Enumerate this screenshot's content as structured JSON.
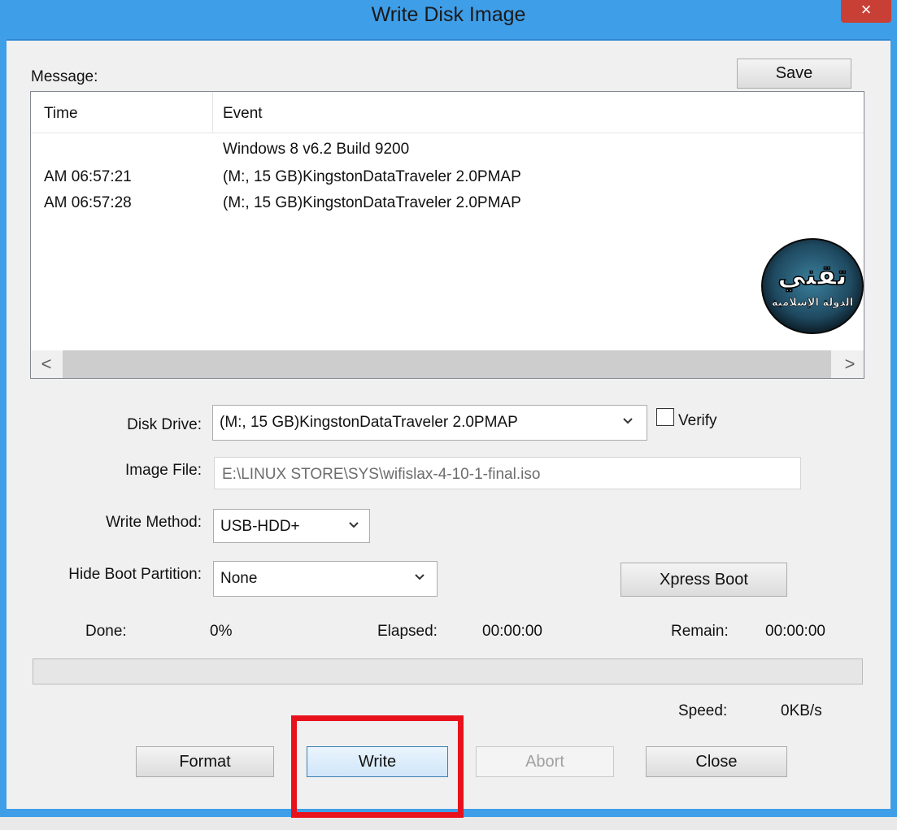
{
  "window": {
    "title": "Write Disk Image",
    "close_glyph": "×"
  },
  "message": {
    "label": "Message:",
    "save_label": "Save",
    "columns": [
      "Time",
      "Event"
    ],
    "rows": [
      {
        "time": "",
        "event": "Windows 8 v6.2 Build 9200"
      },
      {
        "time": "AM 06:57:21",
        "event": "(M:, 15 GB)KingstonDataTraveler 2.0PMAP"
      },
      {
        "time": "AM 06:57:28",
        "event": "(M:, 15 GB)KingstonDataTraveler 2.0PMAP"
      }
    ],
    "scroll_left": "<",
    "scroll_right": ">"
  },
  "watermark": {
    "main": "تقني",
    "sub": "الدولة الإسلامية"
  },
  "form": {
    "disk_drive_label": "Disk Drive:",
    "disk_drive_value": "(M:, 15 GB)KingstonDataTraveler 2.0PMAP",
    "verify_label": "Verify",
    "verify_checked": false,
    "image_file_label": "Image File:",
    "image_file_value": "E:\\LINUX STORE\\SYS\\wifislax-4-10-1-final.iso",
    "write_method_label": "Write Method:",
    "write_method_value": "USB-HDD+",
    "hide_boot_label": "Hide Boot Partition:",
    "hide_boot_value": "None",
    "xpress_boot_label": "Xpress Boot"
  },
  "status": {
    "done_label": "Done:",
    "done_value": "0%",
    "elapsed_label": "Elapsed:",
    "elapsed_value": "00:00:00",
    "remain_label": "Remain:",
    "remain_value": "00:00:00",
    "speed_label": "Speed:",
    "speed_value": "0KB/s",
    "progress_fraction": 0
  },
  "buttons": {
    "format": "Format",
    "write": "Write",
    "abort": "Abort",
    "close": "Close"
  },
  "colors": {
    "title_bar": "#3f9ee8",
    "close_button": "#c84035",
    "highlight_box": "#e8121c"
  },
  "icons": {
    "dropdown": "chevron-down-icon",
    "close": "close-icon"
  }
}
